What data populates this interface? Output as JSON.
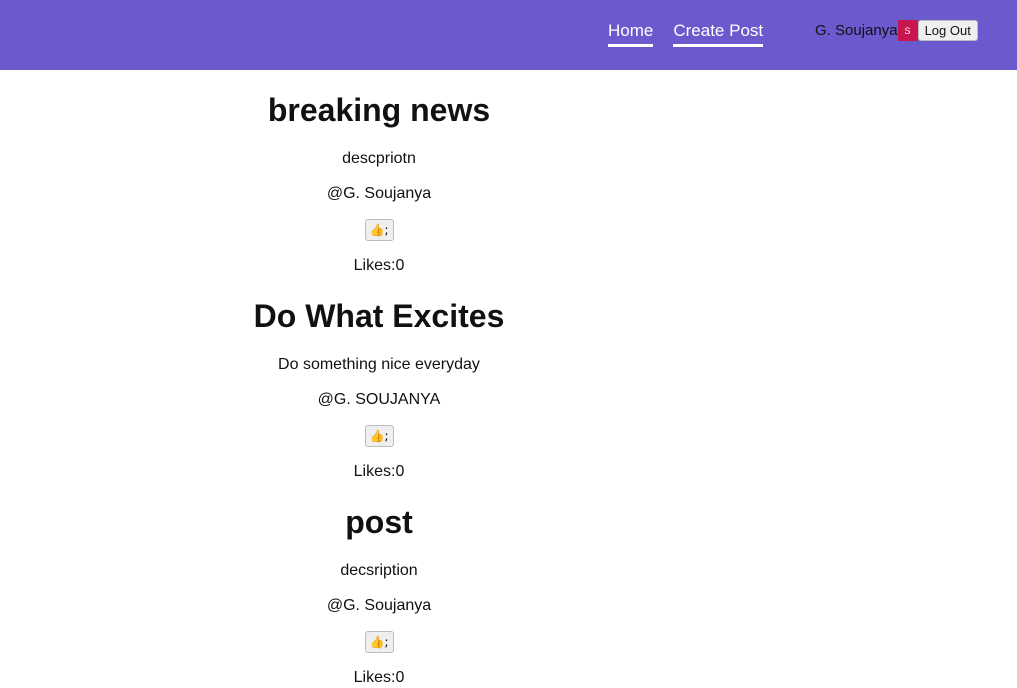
{
  "nav": {
    "links": [
      {
        "label": "Home"
      },
      {
        "label": "Create Post"
      }
    ],
    "user": {
      "name": "G. Soujanya",
      "avatar_letter": "S",
      "logout_label": "Log Out"
    }
  },
  "posts": [
    {
      "title": "breaking news",
      "description": "descpriotn",
      "author": "@G. Soujanya",
      "like_label": "👍;",
      "likes": "Likes:0"
    },
    {
      "title": "Do What Excites",
      "description": "Do something nice everyday",
      "author": "@G. SOUJANYA",
      "like_label": "👍;",
      "likes": "Likes:0"
    },
    {
      "title": "post",
      "description": "decsription",
      "author": "@G. Soujanya",
      "like_label": "👍;",
      "likes": "Likes:0"
    }
  ],
  "colors": {
    "navbar_bg": "#6a5acd",
    "avatar_bg": "#c8174f"
  }
}
